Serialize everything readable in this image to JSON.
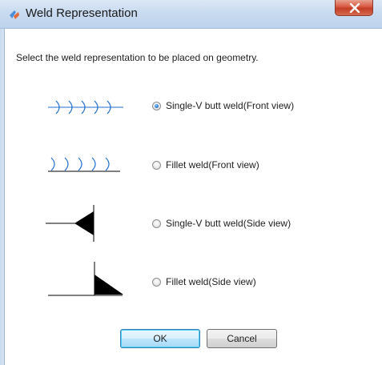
{
  "window": {
    "title": "Weld Representation",
    "close_glyph": "X"
  },
  "instruction": "Select the weld representation to be placed on geometry.",
  "options": [
    {
      "label": "Single-V butt weld(Front view)",
      "checked": true,
      "icon": "single-v-front-symbol"
    },
    {
      "label": "Fillet weld(Front view)",
      "checked": false,
      "icon": "fillet-front-symbol"
    },
    {
      "label": "Single-V butt weld(Side view)",
      "checked": false,
      "icon": "single-v-side-symbol"
    },
    {
      "label": "Fillet weld(Side view)",
      "checked": false,
      "icon": "fillet-side-symbol"
    }
  ],
  "buttons": {
    "ok": "OK",
    "cancel": "Cancel"
  },
  "colors": {
    "weld_arc": "#1f6fd1",
    "symbol_stroke": "#000000"
  }
}
